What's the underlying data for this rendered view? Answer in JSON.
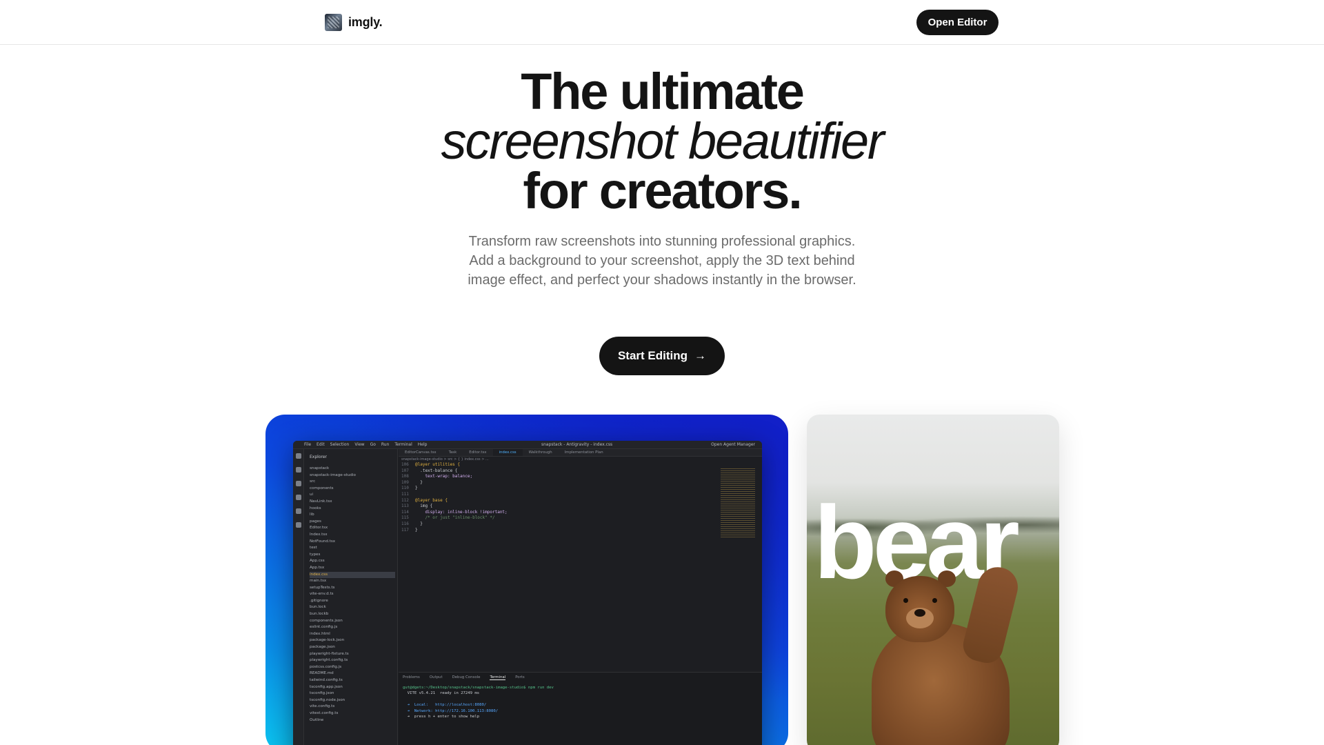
{
  "nav": {
    "brand": "imgly.",
    "open_editor": "Open Editor"
  },
  "hero": {
    "line1": "The ultimate",
    "line2": "screenshot beautifier",
    "line3": "for creators.",
    "description": "Transform raw screenshots into stunning professional graphics. Add a background to your screenshot, apply the 3D text behind image effect, and perfect your shadows instantly in the browser.",
    "cta_label": "Start Editing",
    "cta_icon": "arrow-right-icon"
  },
  "showcase": {
    "editor_card": {
      "menu": [
        "File",
        "Edit",
        "Selection",
        "View",
        "Go",
        "Run",
        "Terminal",
        "Help"
      ],
      "window_title": "snapstack - Antigravity - index.css",
      "right_title": "Open Agent Manager",
      "explorer_title": "Explorer",
      "tree": [
        "snapstack",
        "snapstack-image-studio",
        "src",
        "components",
        "ui",
        "NavLink.tsx",
        "hooks",
        "lib",
        "pages",
        "Editor.tsx",
        "Index.tsx",
        "NotFound.tsx",
        "test",
        "types",
        "App.css",
        "App.tsx",
        "index.css",
        "main.tsx",
        "setupTests.ts",
        "vite-env.d.ts",
        ".gitignore",
        "bun.lock",
        "bun.lockb",
        "components.json",
        "eslint.config.js",
        "index.html",
        "package-lock.json",
        "package.json",
        "playwright-fixture.ts",
        "playwright.config.ts",
        "postcss.config.js",
        "README.md",
        "tailwind.config.ts",
        "tsconfig.app.json",
        "tsconfig.json",
        "tsconfig.node.json",
        "vite.config.ts",
        "vitest.config.ts",
        "Outline"
      ],
      "selected_file": "index.css",
      "tabs": [
        "EditorCanvas.tsx",
        "Task",
        "Editor.tsx",
        "index.css",
        "Walkthrough",
        "Implementation Plan"
      ],
      "active_tab": "index.css",
      "breadcrumb": "snapstack-image-studio > src > { } index.css > ...",
      "code_lines": [
        {
          "n": "106",
          "t": "@layer utilities {"
        },
        {
          "n": "107",
          "t": "  .text-balance {"
        },
        {
          "n": "108",
          "t": "    text-wrap: balance;"
        },
        {
          "n": "109",
          "t": "  }"
        },
        {
          "n": "110",
          "t": "}"
        },
        {
          "n": "111",
          "t": ""
        },
        {
          "n": "112",
          "t": "@layer base {"
        },
        {
          "n": "113",
          "t": "  img {"
        },
        {
          "n": "114",
          "t": "    display: inline-block !important;"
        },
        {
          "n": "115",
          "t": "    /* or just \"inline-block\" */"
        },
        {
          "n": "116",
          "t": "  }"
        },
        {
          "n": "117",
          "t": "}"
        }
      ],
      "panel_tabs": [
        "Problems",
        "Output",
        "Debug Console",
        "Terminal",
        "Ports"
      ],
      "active_panel_tab": "Terminal",
      "terminal_title": "npm - snapstack-image-studio",
      "terminal": [
        "gut@dgets:~/Desktop/snapstack/snapstack-image-studio$ npm run dev",
        "  VITE v5.4.21  ready in 27249 ms",
        "",
        "  ➜  Local:   http://localhost:8080/",
        "  ➜  Network: http://172.16.100.113:8080/",
        "  ➜  press h + enter to show help"
      ]
    },
    "bear_card": {
      "word": "bear"
    }
  }
}
